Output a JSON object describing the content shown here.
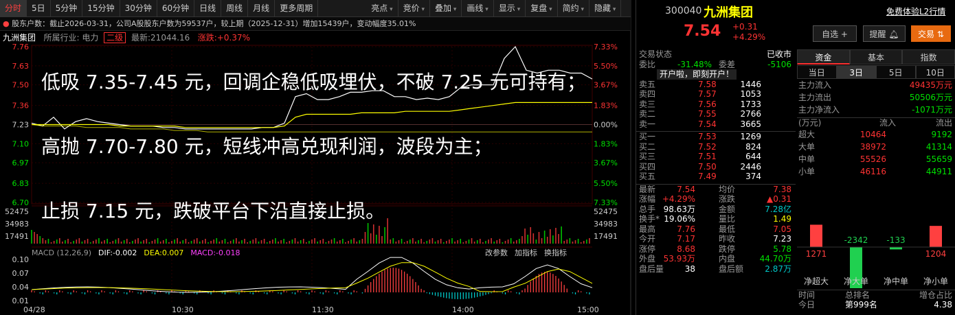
{
  "toolbar": {
    "tabs": [
      "分时",
      "5日",
      "5分钟",
      "15分钟",
      "30分钟",
      "60分钟",
      "日线",
      "周线",
      "月线",
      "更多周期"
    ],
    "right": [
      "亮点",
      "竞价",
      "叠加",
      "画线",
      "显示",
      "复盘",
      "简约",
      "隐藏"
    ]
  },
  "notice": "股东户数：截止2026-03-31，公司A股股东户数为59537户，较上期（2025-12-31）增加15439户，变动幅度35.01%",
  "info": {
    "name": "九洲集团",
    "industry": "所属行业: 电力",
    "level": "二级",
    "latest": "最新:21044.16",
    "change": "涨跌:+0.37%"
  },
  "price_axis_left": [
    "7.76",
    "7.63",
    "7.50",
    "7.36",
    "7.23",
    "7.10",
    "6.97",
    "6.83",
    "6.70"
  ],
  "price_axis_right": [
    "7.33%",
    "5.50%",
    "3.67%",
    "1.83%",
    "0.00%",
    "1.83%",
    "3.67%",
    "5.50%",
    "7.33%"
  ],
  "vol_axis": [
    "52475",
    "34983",
    "17491"
  ],
  "macd": {
    "label": "MACD (12,26,9)",
    "dif": "DIF:-0.002",
    "dea": "DEA:0.007",
    "macd": "MACD:-0.018",
    "buttons": [
      "改参数",
      "加指标",
      "换指标"
    ],
    "axis": [
      "0.10",
      "0.07",
      "0.04",
      "0.01"
    ]
  },
  "time_axis": [
    "04/28",
    "10:30",
    "11:30",
    "14:00",
    "15:00"
  ],
  "overlay_text": [
    "低吸 7.35-7.45 元，回调企稳低吸埋伏，不破 7.25 元可持有；",
    "高抛 7.70-7.80 元，短线冲高兑现利润，波段为主；",
    "止损 7.15 元，跌破平台下沿直接止损。"
  ],
  "chart_data": {
    "type": "line",
    "x_range": [
      "09:30",
      "15:00"
    ],
    "prev_close": 7.23,
    "ylim": [
      6.7,
      7.76
    ],
    "series": [
      {
        "values": [
          7.24,
          7.22,
          7.28,
          7.2,
          7.25,
          7.27,
          7.25,
          7.24,
          7.23,
          7.22,
          7.22,
          7.22,
          7.21,
          7.21,
          7.2,
          7.2,
          7.2,
          7.2,
          7.2,
          7.2,
          7.2,
          7.21,
          7.21,
          7.24,
          7.42,
          7.44,
          7.4,
          7.4,
          7.42,
          7.45,
          7.45,
          7.46,
          7.46,
          7.42,
          7.42,
          7.4,
          7.41,
          7.4,
          7.42,
          7.48,
          7.5,
          7.5,
          7.5,
          7.68,
          7.76,
          7.6,
          7.58,
          7.6,
          7.6,
          7.58,
          7.58,
          7.54
        ]
      },
      {
        "values": [
          7.23,
          7.23,
          7.23,
          7.23,
          7.23,
          7.23,
          7.23,
          7.23,
          7.22,
          7.22,
          7.22,
          7.22,
          7.22,
          7.22,
          7.21,
          7.21,
          7.21,
          7.21,
          7.21,
          7.21,
          7.21,
          7.21,
          7.21,
          7.22,
          7.28,
          7.3,
          7.3,
          7.3,
          7.3,
          7.3,
          7.31,
          7.31,
          7.31,
          7.31,
          7.32,
          7.32,
          7.32,
          7.32,
          7.32,
          7.33,
          7.34,
          7.35,
          7.36,
          7.37,
          7.38,
          7.38,
          7.38,
          7.38,
          7.38,
          7.38,
          7.38,
          7.38
        ]
      },
      {
        "values": [
          7.23,
          7.22,
          7.22,
          7.22,
          7.22,
          7.21,
          7.21,
          7.21,
          7.21,
          7.2,
          7.2,
          7.2,
          7.2,
          7.19,
          7.19,
          7.19,
          7.18,
          7.18,
          7.18,
          7.18,
          7.18,
          7.18,
          7.18,
          7.18,
          7.18,
          7.18,
          7.18,
          7.18,
          7.18,
          7.18,
          7.18,
          7.18,
          7.18,
          7.18,
          7.18,
          7.18,
          7.18,
          7.18,
          7.18,
          7.18,
          7.18,
          7.18,
          7.18,
          7.18,
          7.18,
          7.18,
          7.18,
          7.18,
          7.18,
          7.18,
          7.18,
          7.18
        ]
      }
    ]
  },
  "stock": {
    "code": "300040",
    "name": "九洲集团",
    "trial": "免费体验L2行情",
    "price": "7.54",
    "chg": "+0.31",
    "pct": "+4.29%",
    "btn_add": "自选 +",
    "btn_alert": "提醒",
    "btn_trade": "交易"
  },
  "book": {
    "status_label": "交易状态",
    "status": "已收市",
    "ratio_label": "委比",
    "ratio": "-31.48%",
    "diff_label": "委差",
    "diff": "-5106",
    "promo": "开户啦，即刻开户！",
    "asks": [
      {
        "l": "卖五",
        "p": "7.58",
        "v": "1446"
      },
      {
        "l": "卖四",
        "p": "7.57",
        "v": "1053"
      },
      {
        "l": "卖三",
        "p": "7.56",
        "v": "1733"
      },
      {
        "l": "卖二",
        "p": "7.55",
        "v": "2766"
      },
      {
        "l": "卖一",
        "p": "7.54",
        "v": "3665"
      }
    ],
    "bids": [
      {
        "l": "买一",
        "p": "7.53",
        "v": "1269"
      },
      {
        "l": "买二",
        "p": "7.52",
        "v": "824"
      },
      {
        "l": "买三",
        "p": "7.51",
        "v": "644"
      },
      {
        "l": "买四",
        "p": "7.50",
        "v": "2446"
      },
      {
        "l": "买五",
        "p": "7.49",
        "v": "374"
      }
    ],
    "stats": [
      {
        "a": "最新",
        "av": "7.54",
        "b": "均价",
        "bv": "7.38"
      },
      {
        "a": "涨幅",
        "av": "+4.29%",
        "b": "涨跌",
        "bv": "▲0.31"
      },
      {
        "a": "总手",
        "av": "98.63万",
        "b": "金额",
        "bv": "7.28亿"
      },
      {
        "a": "换手*",
        "av": "19.06%",
        "b": "量比",
        "bv": "1.49"
      },
      {
        "a": "最高",
        "av": "7.76",
        "b": "最低",
        "bv": "7.05"
      },
      {
        "a": "今开",
        "av": "7.17",
        "b": "昨收",
        "bv": "7.23"
      },
      {
        "a": "涨停",
        "av": "8.68",
        "b": "跌停",
        "bv": "5.78"
      },
      {
        "a": "外盘",
        "av": "53.93万",
        "b": "内盘",
        "bv": "44.70万"
      },
      {
        "a": "盘后量",
        "av": "38",
        "b": "盘后额",
        "bv": "2.87万"
      }
    ]
  },
  "fund": {
    "tabs": [
      "资金",
      "基本",
      "指数"
    ],
    "days": [
      "当日",
      "3日",
      "5日",
      "10日"
    ],
    "main_in_label": "主力流入",
    "main_in": "49435万元",
    "main_out_label": "主力流出",
    "main_out": "50506万元",
    "main_net_label": "主力净流入",
    "main_net": "-1071万元",
    "unit": "(万元)",
    "col_in": "流入",
    "col_out": "流出",
    "rows": [
      {
        "l": "超大",
        "i": "10464",
        "o": "9192"
      },
      {
        "l": "大单",
        "i": "38972",
        "o": "41314"
      },
      {
        "l": "中单",
        "i": "55526",
        "o": "55659"
      },
      {
        "l": "小单",
        "i": "46116",
        "o": "44911"
      }
    ],
    "net_bars": [
      {
        "label": "净超大",
        "value": 1271
      },
      {
        "label": "净大单",
        "value": -2342
      },
      {
        "label": "净中单",
        "value": -133
      },
      {
        "label": "净小单",
        "value": 1204
      }
    ],
    "bottom": [
      "时间",
      "总排名",
      "增仓占比"
    ],
    "bottom_row": [
      "今日",
      "第999名",
      "4.38"
    ]
  }
}
